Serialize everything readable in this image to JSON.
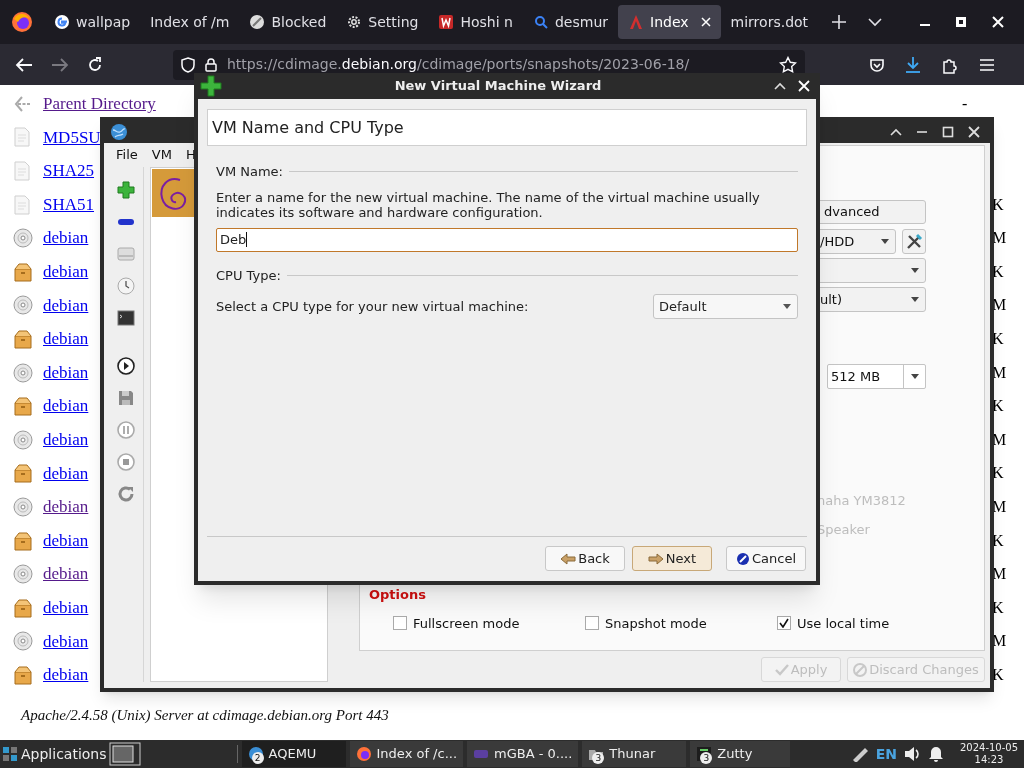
{
  "browser": {
    "tabs": [
      {
        "label": "wallpap",
        "selected": false
      },
      {
        "label": "Index of /m",
        "selected": false
      },
      {
        "label": "Blocked",
        "selected": false
      },
      {
        "label": "Setting",
        "selected": false
      },
      {
        "label": "Hoshi n",
        "selected": false
      },
      {
        "label": "desmur",
        "selected": false
      },
      {
        "label": "Index",
        "selected": true
      },
      {
        "label": "mirrors.dot",
        "selected": false
      }
    ],
    "url": {
      "host_prefix": "https://cdimage.",
      "host": "debian.org",
      "path": "/cdimage/ports/snapshots/2023-06-18/"
    },
    "listing": [
      {
        "kind": "parent",
        "name": "Parent Directory",
        "visited": true,
        "size": "-"
      },
      {
        "kind": "text",
        "name": "MD5SU",
        "visited": false
      },
      {
        "kind": "text",
        "name": "SHA25",
        "visited": false
      },
      {
        "kind": "text",
        "name": "SHA51",
        "visited": false,
        "size": "K"
      },
      {
        "kind": "disc",
        "name": "debian",
        "visited": false,
        "size": "M"
      },
      {
        "kind": "package",
        "name": "debian",
        "visited": false,
        "size": "K"
      },
      {
        "kind": "disc",
        "name": "debian",
        "visited": false,
        "size": "M"
      },
      {
        "kind": "package",
        "name": "debian",
        "visited": false,
        "size": "K"
      },
      {
        "kind": "disc",
        "name": "debian",
        "visited": false,
        "size": "M"
      },
      {
        "kind": "package",
        "name": "debian",
        "visited": false,
        "size": "K"
      },
      {
        "kind": "disc",
        "name": "debian",
        "visited": false,
        "size": "M"
      },
      {
        "kind": "package",
        "name": "debian",
        "visited": false,
        "size": "K"
      },
      {
        "kind": "disc",
        "name": "debian",
        "visited": true,
        "size": "M"
      },
      {
        "kind": "package",
        "name": "debian",
        "visited": false,
        "size": "K"
      },
      {
        "kind": "disc",
        "name": "debian",
        "visited": true,
        "size": "M"
      },
      {
        "kind": "package",
        "name": "debian",
        "visited": false,
        "size": "K"
      },
      {
        "kind": "disc",
        "name": "debian",
        "visited": false,
        "size": "M"
      },
      {
        "kind": "package",
        "name": "debian",
        "visited": false,
        "size": "K"
      }
    ],
    "footer": "Apache/2.4.58 (Unix) Server at cdimage.debian.org Port 443"
  },
  "aqemu": {
    "menu": [
      "File",
      "VM",
      "H"
    ],
    "panel": {
      "advanced_button": "dvanced",
      "storage_combo": "/HDD",
      "combo_4": "ult)",
      "memory_combo": "512 MB",
      "sound_cards": [
        "naha YM3812",
        "Speaker"
      ],
      "options_title": "Options",
      "options": [
        {
          "label": "Fullscreen mode",
          "checked": false
        },
        {
          "label": "Snapshot mode",
          "checked": false
        },
        {
          "label": "Use local time",
          "checked": true
        }
      ]
    },
    "buttons": [
      {
        "label": "Apply",
        "disabled": true
      },
      {
        "label": "Discard Changes",
        "disabled": true
      }
    ]
  },
  "wizard": {
    "title": "New Virtual Machine Wizard",
    "header": "VM Name and CPU Type",
    "name_section": "VM Name:",
    "description": "Enter a name for the new virtual machine. The name of the virtual machine usually indicates its software and hardware configuration.",
    "name_value": "Deb",
    "cpu_section": "CPU Type:",
    "cpu_prompt": "Select a CPU type for your new virtual machine:",
    "cpu_combo": "Default",
    "buttons": [
      {
        "label": "Back",
        "default": false
      },
      {
        "label": "Next",
        "default": true
      },
      {
        "label": "Cancel",
        "default": false
      }
    ]
  },
  "taskbar": {
    "menu": "Applications",
    "tasks": [
      {
        "label": "AQEMU",
        "badge": "2",
        "selected": true
      },
      {
        "label": "Index of /c...",
        "selected": false
      },
      {
        "label": "mGBA - 0....",
        "selected": false
      },
      {
        "label": "Thunar",
        "badge": "3",
        "selected": false
      },
      {
        "label": "Zutty",
        "badge": "3",
        "selected": false
      }
    ],
    "keyboard": "EN",
    "date": "2024-10-05",
    "time": "14:23"
  }
}
